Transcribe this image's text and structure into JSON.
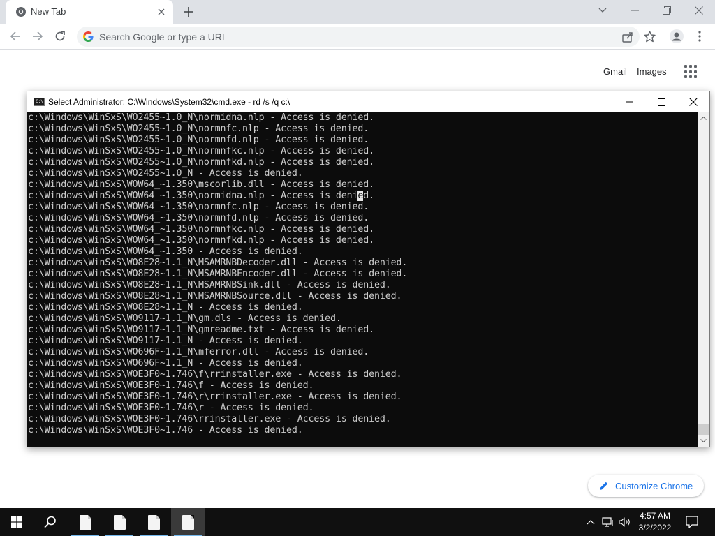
{
  "browser": {
    "tab": {
      "title": "New Tab"
    },
    "omnibox": {
      "placeholder": "Search Google or type a URL"
    }
  },
  "ntp": {
    "links": [
      "Gmail",
      "Images"
    ],
    "customize_label": "Customize Chrome"
  },
  "cmd_window": {
    "title": "Select Administrator: C:\\Windows\\System32\\cmd.exe - rd  /s /q c:\\",
    "lines": [
      "c:\\Windows\\WinSxS\\WO2455~1.0_N\\normidna.nlp - Access is denied.",
      "c:\\Windows\\WinSxS\\WO2455~1.0_N\\normnfc.nlp - Access is denied.",
      "c:\\Windows\\WinSxS\\WO2455~1.0_N\\normnfd.nlp - Access is denied.",
      "c:\\Windows\\WinSxS\\WO2455~1.0_N\\normnfkc.nlp - Access is denied.",
      "c:\\Windows\\WinSxS\\WO2455~1.0_N\\normnfkd.nlp - Access is denied.",
      "c:\\Windows\\WinSxS\\WO2455~1.0_N - Access is denied.",
      "c:\\Windows\\WinSxS\\WOW64_~1.350\\mscorlib.dll - Access is denied.",
      "c:\\Windows\\WinSxS\\WOW64_~1.350\\normidna.nlp - Access is denied.",
      "c:\\Windows\\WinSxS\\WOW64_~1.350\\normnfc.nlp - Access is denied.",
      "c:\\Windows\\WinSxS\\WOW64_~1.350\\normnfd.nlp - Access is denied.",
      "c:\\Windows\\WinSxS\\WOW64_~1.350\\normnfkc.nlp - Access is denied.",
      "c:\\Windows\\WinSxS\\WOW64_~1.350\\normnfkd.nlp - Access is denied.",
      "c:\\Windows\\WinSxS\\WOW64_~1.350 - Access is denied.",
      "c:\\Windows\\WinSxS\\WO8E28~1.1_N\\MSAMRNBDecoder.dll - Access is denied.",
      "c:\\Windows\\WinSxS\\WO8E28~1.1_N\\MSAMRNBEncoder.dll - Access is denied.",
      "c:\\Windows\\WinSxS\\WO8E28~1.1_N\\MSAMRNBSink.dll - Access is denied.",
      "c:\\Windows\\WinSxS\\WO8E28~1.1_N\\MSAMRNBSource.dll - Access is denied.",
      "c:\\Windows\\WinSxS\\WO8E28~1.1_N - Access is denied.",
      "c:\\Windows\\WinSxS\\WO9117~1.1_N\\gm.dls - Access is denied.",
      "c:\\Windows\\WinSxS\\WO9117~1.1_N\\gmreadme.txt - Access is denied.",
      "c:\\Windows\\WinSxS\\WO9117~1.1_N - Access is denied.",
      "c:\\Windows\\WinSxS\\WO696F~1.1_N\\mferror.dll - Access is denied.",
      "c:\\Windows\\WinSxS\\WO696F~1.1_N - Access is denied.",
      "c:\\Windows\\WinSxS\\WOE3F0~1.746\\f\\rrinstaller.exe - Access is denied.",
      "c:\\Windows\\WinSxS\\WOE3F0~1.746\\f - Access is denied.",
      "c:\\Windows\\WinSxS\\WOE3F0~1.746\\r\\rrinstaller.exe - Access is denied.",
      "c:\\Windows\\WinSxS\\WOE3F0~1.746\\r - Access is denied.",
      "c:\\Windows\\WinSxS\\WOE3F0~1.746\\rrinstaller.exe - Access is denied.",
      "c:\\Windows\\WinSxS\\WOE3F0~1.746 - Access is denied."
    ],
    "selection": {
      "line": 7,
      "char": "e"
    }
  },
  "taskbar": {
    "time": "4:57 AM",
    "date": "3/2/2022"
  },
  "colors": {
    "chrome_tabstrip": "#dee1e6",
    "console_bg": "#0c0c0c",
    "console_text": "#cccccc",
    "link_blue": "#1a73e8",
    "taskbar_bg": "#101010"
  }
}
